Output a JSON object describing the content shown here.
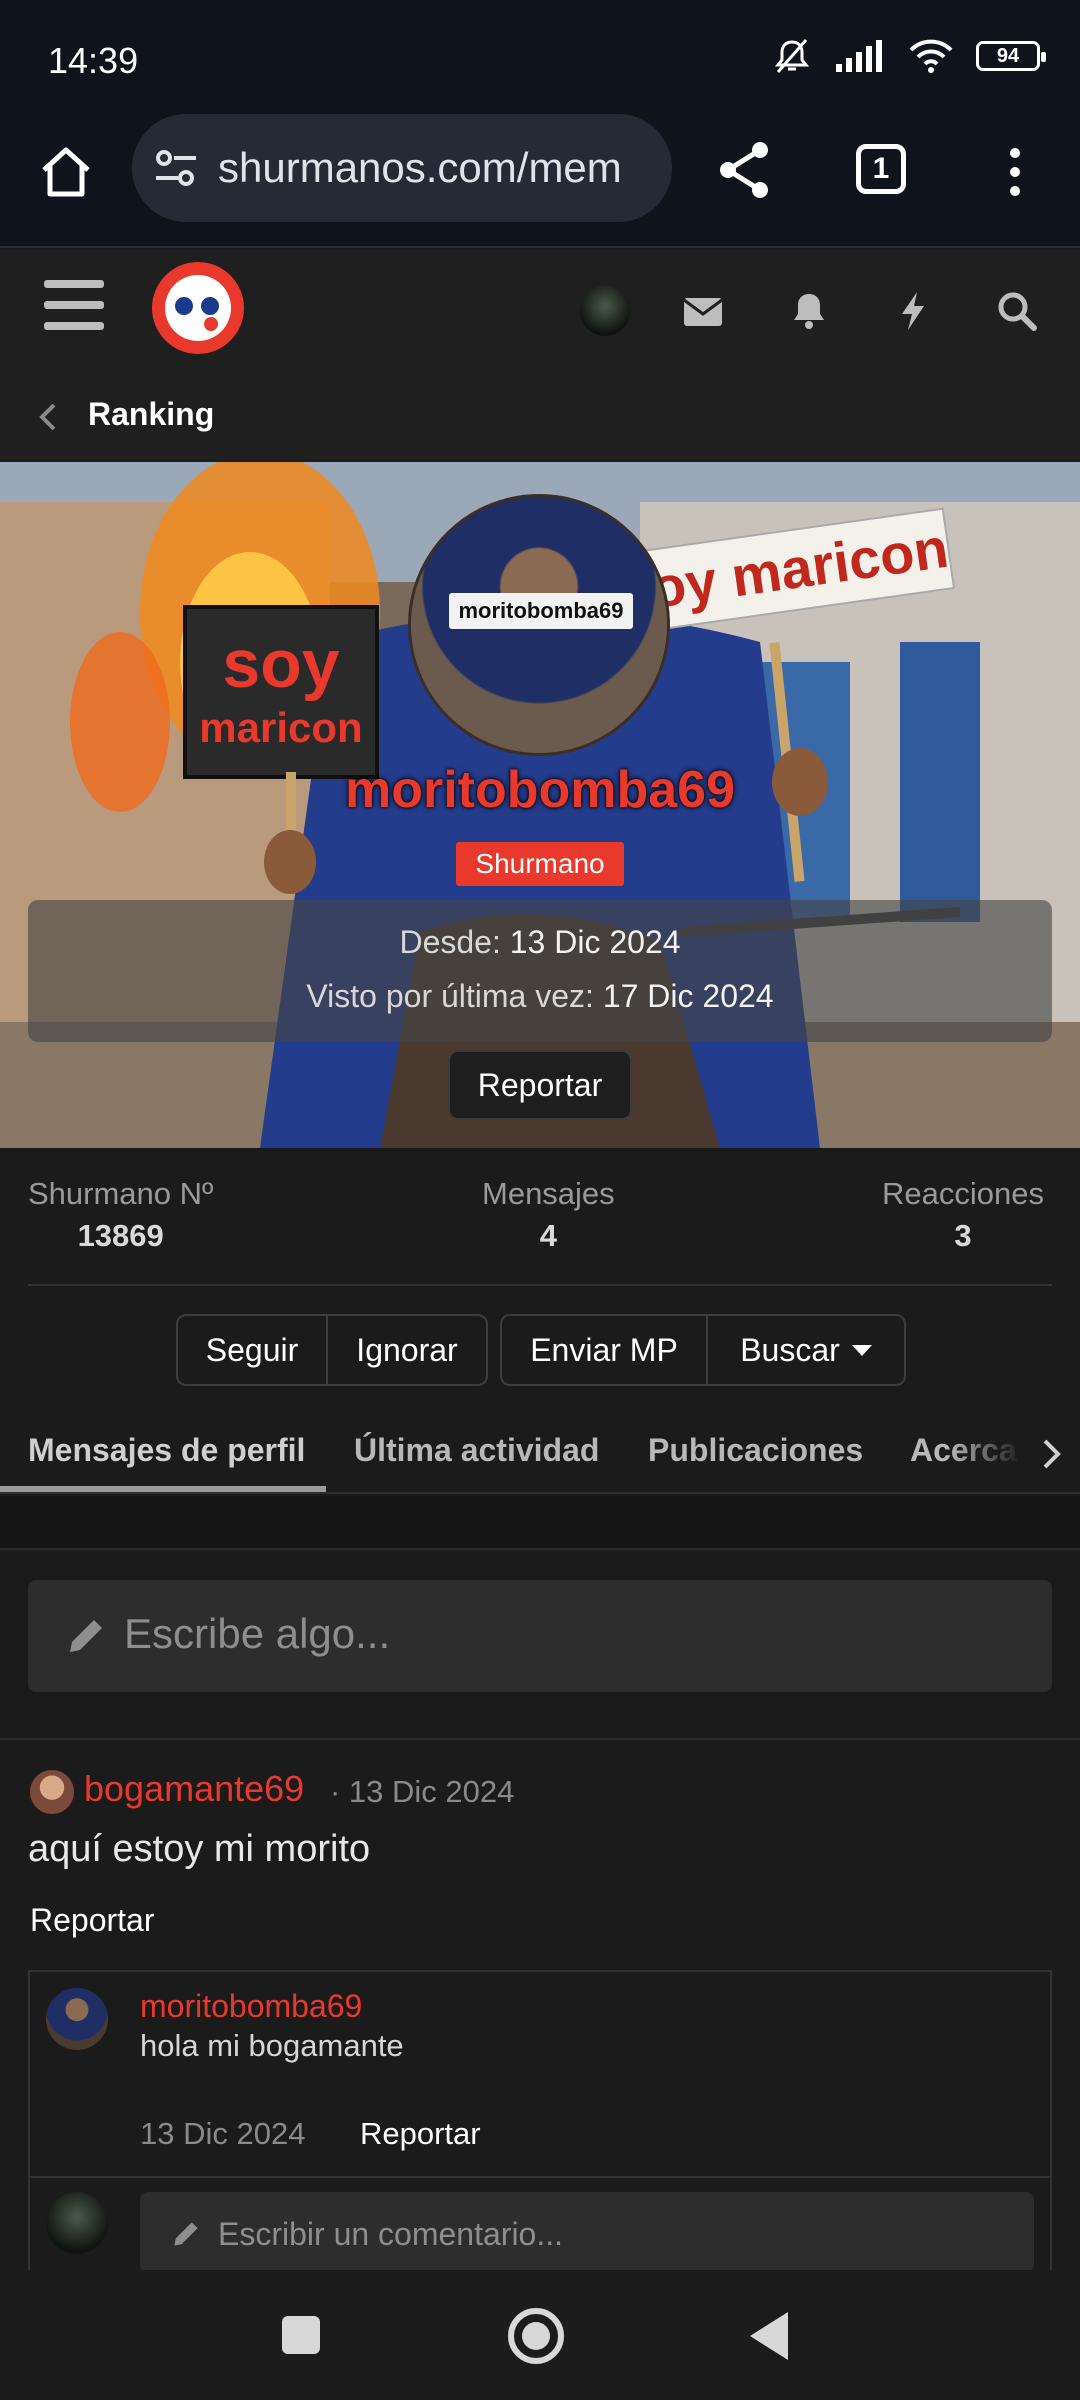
{
  "status": {
    "time": "14:39",
    "battery": "94"
  },
  "browser": {
    "url": "shurmanos.com/mem",
    "tab_count": "1"
  },
  "breadcrumb": {
    "label": "Ranking"
  },
  "profile": {
    "avatar_sign_text": "moritobomba69",
    "username": "moritobomba69",
    "role": "Shurmano",
    "since_label": "Desde:",
    "since_value": "13 Dic 2024",
    "last_seen_label": "Visto por última vez:",
    "last_seen_value": "17 Dic 2024",
    "report_label": "Reportar"
  },
  "stats": [
    {
      "label": "Shurmano Nº",
      "value": "13869"
    },
    {
      "label": "Mensajes",
      "value": "4"
    },
    {
      "label": "Reacciones",
      "value": "3"
    }
  ],
  "actions": {
    "follow": "Seguir",
    "ignore": "Ignorar",
    "send_pm": "Enviar MP",
    "search": "Buscar"
  },
  "tabs": [
    "Mensajes de perfil",
    "Última actividad",
    "Publicaciones",
    "Acerca"
  ],
  "composer": {
    "placeholder": "Escribe algo..."
  },
  "post": {
    "author": "bogamante69",
    "date": "· 13 Dic 2024",
    "body": "aquí estoy mi morito",
    "report": "Reportar",
    "comment": {
      "author": "moritobomba69",
      "text": "hola mi bogamante",
      "date": "13 Dic 2024",
      "report": "Reportar"
    },
    "reply_placeholder": "Escribir un comentario..."
  },
  "banner_signs": {
    "left": "soy maricon",
    "right": "oy maricon"
  },
  "colors": {
    "accent": "#e8392c",
    "background": "#1b1b1b",
    "chrome": "#0f141c"
  }
}
